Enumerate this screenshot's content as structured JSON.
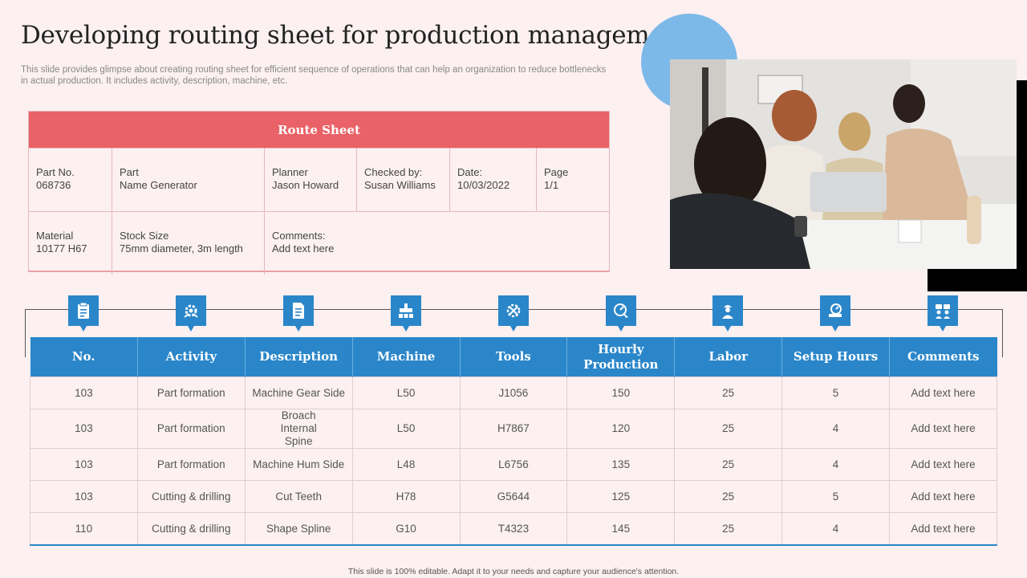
{
  "slide": {
    "title": "Developing routing sheet for production management",
    "subtitle": "This slide provides glimpse about creating routing sheet for efficient sequence of operations that can help an organization to reduce bottlenecks in actual production. It includes activity, description, machine, etc.",
    "footer": "This slide is 100% editable. Adapt it to your needs and capture your audience's attention."
  },
  "route_sheet": {
    "title": "Route Sheet",
    "part_no_label": "Part No.",
    "part_no_value": "068736",
    "part_label": "Part",
    "part_value": "Name Generator",
    "planner_label": "Planner",
    "planner_value": "Jason Howard",
    "checked_label": "Checked by:",
    "checked_value": "Susan Williams",
    "date_label": "Date:",
    "date_value": "10/03/2022",
    "page_label": "Page",
    "page_value": "1/1",
    "material_label": "Material",
    "material_value": "10177 H67",
    "stock_label": "Stock Size",
    "stock_value": "75mm diameter, 3m length",
    "comments_label": "Comments:",
    "comments_value": "Add text here"
  },
  "icons": [
    "clipboard-icon",
    "activity-gear-icon",
    "document-icon",
    "machine-icon",
    "tools-icon",
    "speed-gauge-icon",
    "worker-icon",
    "setup-timer-icon",
    "comments-icon"
  ],
  "table": {
    "headers": [
      "No.",
      "Activity",
      "Description",
      "Machine",
      "Tools",
      "Hourly Production",
      "Labor",
      "Setup Hours",
      "Comments"
    ],
    "rows": [
      [
        "103",
        "Part formation",
        "Machine Gear Side",
        "L50",
        "J1056",
        "150",
        "25",
        "5",
        "Add text here"
      ],
      [
        "103",
        "Part formation",
        "Broach Internal Spine",
        "L50",
        "H7867",
        "120",
        "25",
        "4",
        "Add text here"
      ],
      [
        "103",
        "Part formation",
        "Machine Hum Side",
        "L48",
        "L6756",
        "135",
        "25",
        "4",
        "Add text here"
      ],
      [
        "103",
        "Cutting & drilling",
        "Cut Teeth",
        "H78",
        "G5644",
        "125",
        "25",
        "5",
        "Add text here"
      ],
      [
        "110",
        "Cutting & drilling",
        "Shape Spline",
        "G10",
        "T4323",
        "145",
        "25",
        "4",
        "Add text here"
      ]
    ]
  },
  "colors": {
    "accent_red": "#e96267",
    "accent_blue": "#2a86c9",
    "circle_blue": "#7db9e8",
    "background": "#fcf0f1"
  }
}
